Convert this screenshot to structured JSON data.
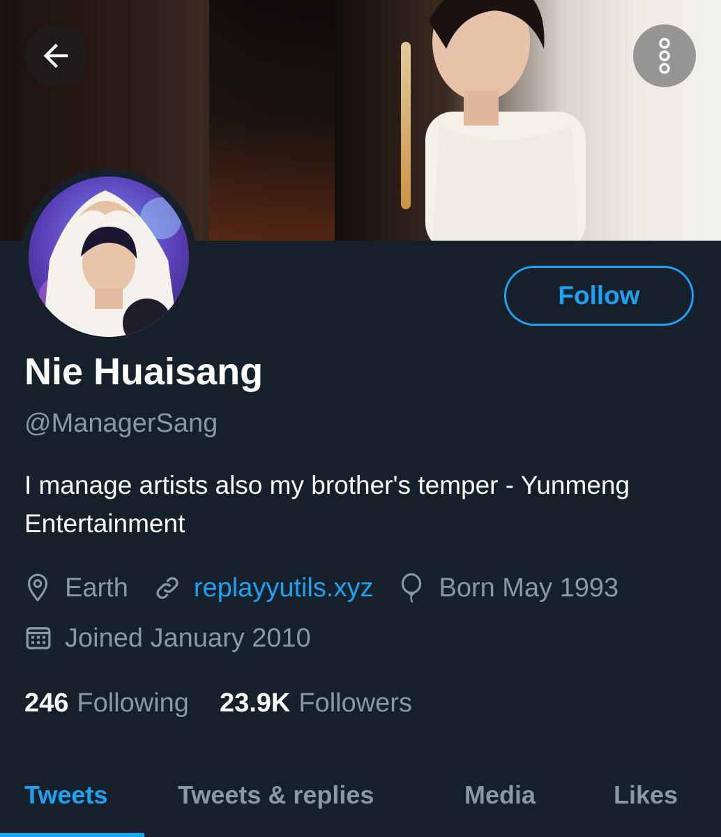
{
  "header": {
    "back_icon": "arrow-left-icon",
    "more_icon": "more-vertical-icon"
  },
  "profile": {
    "display_name": "Nie Huaisang",
    "handle": "@ManagerSang",
    "bio": "I manage artists also my brother's temper - Yunmeng Entertainment",
    "follow_label": "Follow",
    "location": "Earth",
    "website": "replayyutils.xyz",
    "birthday": "Born May 1993",
    "joined": "Joined January 2010",
    "following_count": "246",
    "following_label": "Following",
    "followers_count": "23.9K",
    "followers_label": "Followers"
  },
  "tabs": [
    {
      "label": "Tweets",
      "active": true
    },
    {
      "label": "Tweets & replies",
      "active": false
    },
    {
      "label": "Media",
      "active": false
    },
    {
      "label": "Likes",
      "active": false
    }
  ],
  "colors": {
    "background": "#15202b",
    "accent": "#1da1f2",
    "secondary_text": "#8899a6",
    "primary_text": "#ffffff"
  }
}
